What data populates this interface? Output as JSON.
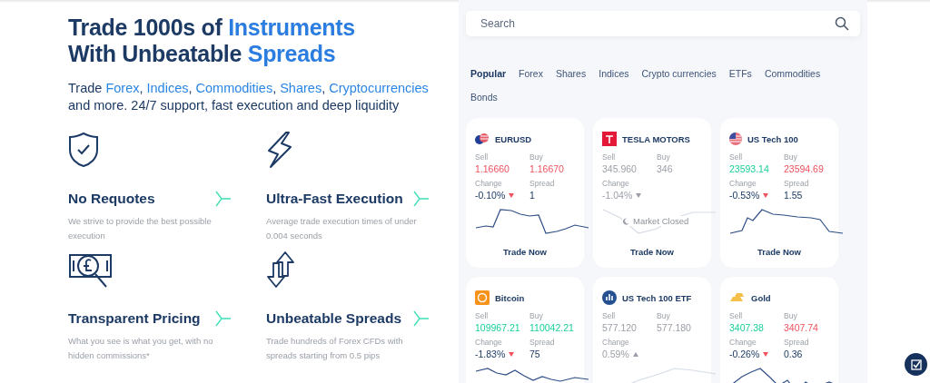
{
  "headline": {
    "lines": [
      [
        {
          "text": "Trade 1000s of ",
          "accent": false
        },
        {
          "text": "Instruments",
          "accent": true
        }
      ],
      [
        {
          "text": "With Unbeatable ",
          "accent": false
        },
        {
          "text": "Spreads",
          "accent": true
        }
      ]
    ]
  },
  "intro": {
    "lead": "Trade",
    "separator": ",",
    "links": [
      "Forex",
      "Indices",
      "Commodities",
      "Shares",
      "Cryptocurrencies"
    ],
    "rest": "and more. 24/7 support, fast execution and deep liquidity"
  },
  "features": [
    {
      "title": "No Requotes",
      "description": "We strive to provide the best possible execution"
    },
    {
      "title": "Ultra-Fast Execution",
      "description": "Average trade execution times of under 0.004 seconds"
    },
    {
      "title": "Transparent Pricing",
      "description": "What you see is what you get, with no hidden commissions*"
    },
    {
      "title": "Unbeatable Spreads",
      "description": "Trade hundreds of Forex CFDs with spreads starting from 0.5 pips"
    }
  ],
  "search": {
    "placeholder": "Search"
  },
  "tabs": [
    {
      "label": "Popular",
      "selected": true
    },
    {
      "label": "Forex",
      "selected": false
    },
    {
      "label": "Shares",
      "selected": false
    },
    {
      "label": "Indices",
      "selected": false
    },
    {
      "label": "Crypto currencies",
      "selected": false
    },
    {
      "label": "ETFs",
      "selected": false
    },
    {
      "label": "Commodities",
      "selected": false
    },
    {
      "label": "Bonds",
      "selected": false
    }
  ],
  "cards": [
    {
      "name": "EURUSD",
      "sell": {
        "label": "Sell",
        "value": "1.16660",
        "color": "#f0515c"
      },
      "buy": {
        "label": "Buy",
        "value": "1.16670",
        "color": "#f0515c"
      },
      "change_label": "Change",
      "change": "-0.10%",
      "change_down": true,
      "spread_label": "Spread",
      "spread": "1",
      "muted": false,
      "action": "Trade Now"
    },
    {
      "name": "TESLA MOTORS",
      "sell": {
        "label": "Sell",
        "value": "345.960",
        "color": "#9a9ea6"
      },
      "buy": {
        "label": "Buy",
        "value": "346",
        "color": "#9a9ea6"
      },
      "change_label": "Change",
      "change": "-1.04%",
      "change_down": true,
      "muted": true,
      "status": "Market Closed",
      "action": "Trade Now"
    },
    {
      "name": "US Tech 100",
      "sell": {
        "label": "Sell",
        "value": "23593.14",
        "color": "#19cf9a"
      },
      "buy": {
        "label": "Buy",
        "value": "23594.69",
        "color": "#f0515c"
      },
      "change_label": "Change",
      "change": "-0.53%",
      "change_down": true,
      "spread_label": "Spread",
      "spread": "1.55",
      "muted": false,
      "action": "Trade Now"
    },
    {
      "name": "Bitcoin",
      "sell": {
        "label": "Sell",
        "value": "109967.21",
        "color": "#19cf9a"
      },
      "buy": {
        "label": "Buy",
        "value": "110042.21",
        "color": "#19cf9a"
      },
      "change_label": "Change",
      "change": "-1.83%",
      "change_down": true,
      "spread_label": "Spread",
      "spread": "75",
      "muted": false
    },
    {
      "name": "US Tech 100 ETF",
      "sell": {
        "label": "Sell",
        "value": "577.120",
        "color": "#9a9ea6"
      },
      "buy": {
        "label": "Buy",
        "value": "577.180",
        "color": "#9a9ea6"
      },
      "change_label": "Change",
      "change": "0.59%",
      "change_down": false,
      "muted": true
    },
    {
      "name": "Gold",
      "sell": {
        "label": "Sell",
        "value": "3407.38",
        "color": "#19cf9a"
      },
      "buy": {
        "label": "Buy",
        "value": "3407.74",
        "color": "#f0515c"
      },
      "change_label": "Change",
      "change": "-0.26%",
      "change_down": true,
      "spread_label": "Spread",
      "spread": "0.36",
      "muted": false
    }
  ]
}
